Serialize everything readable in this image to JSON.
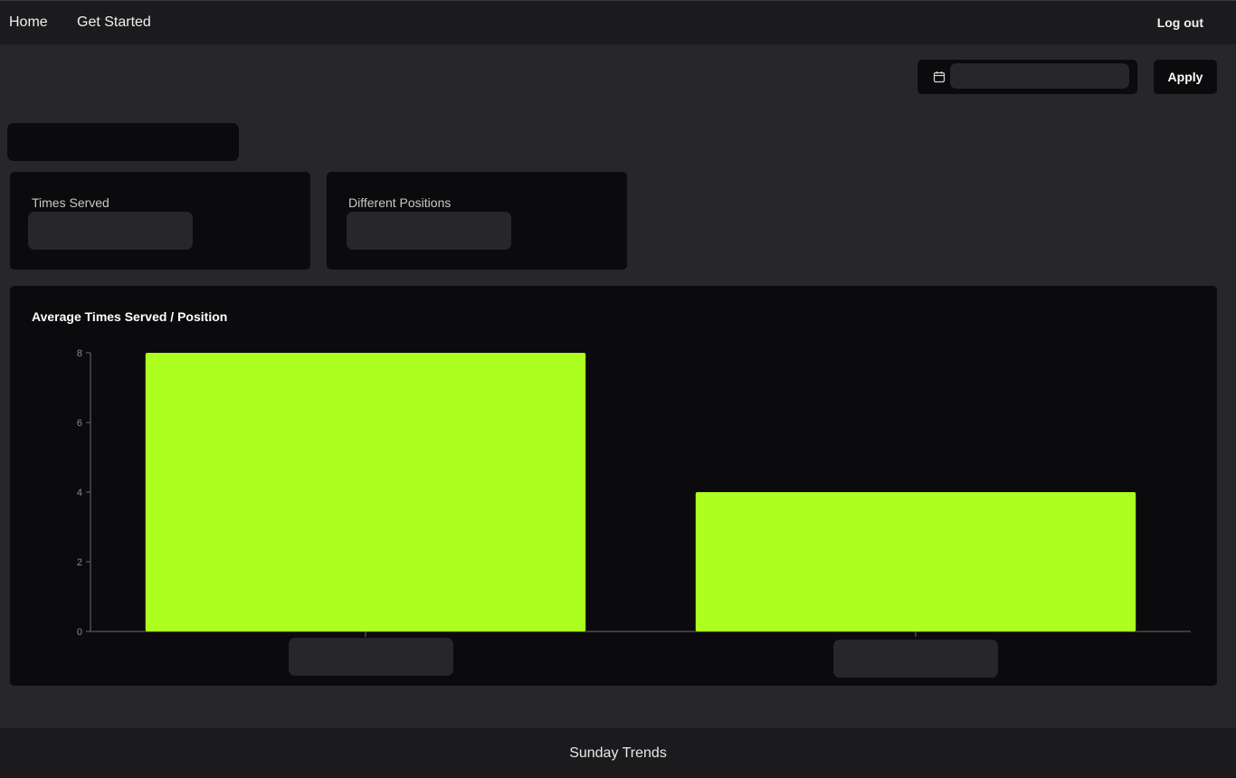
{
  "nav": {
    "home": "Home",
    "get_started": "Get Started",
    "logout": "Log out"
  },
  "filter": {
    "date_value": "",
    "apply_label": "Apply"
  },
  "page_title": "",
  "stats": [
    {
      "label": "Times Served",
      "value": ""
    },
    {
      "label": "Different Positions",
      "value": ""
    }
  ],
  "chart_data": {
    "type": "bar",
    "title": "Average Times Served / Position",
    "categories": [
      "",
      ""
    ],
    "values": [
      8,
      4
    ],
    "ylim": [
      0,
      8
    ],
    "yticks": [
      0,
      2,
      4,
      6,
      8
    ],
    "bar_color": "#adff1f",
    "grid": false
  },
  "footer": {
    "label": "Sunday Trends"
  },
  "colors": {
    "background": "#27272a",
    "card": "#0b0b0d",
    "accent": "#adff1f"
  },
  "icons": {
    "date": "calendar-icon"
  }
}
